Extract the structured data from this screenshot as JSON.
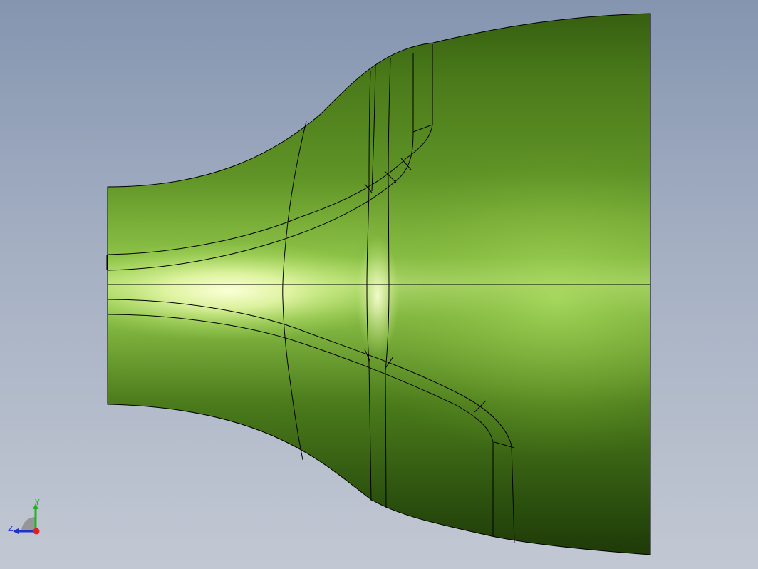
{
  "viewport": {
    "background_top": "#8595b0",
    "background_bottom": "#c2c8d3"
  },
  "model": {
    "part": "flared-nozzle",
    "body_color_highlight": "#fbffd6",
    "body_color_mid": "#8fcf48",
    "body_color_shadow": "#1f3a0a",
    "edge_color": "#000000"
  },
  "triad": {
    "y_label": "Y",
    "z_label": "Z",
    "y_color": "#1fb51f",
    "z_color": "#2030c8",
    "origin_color": "#e02020"
  }
}
